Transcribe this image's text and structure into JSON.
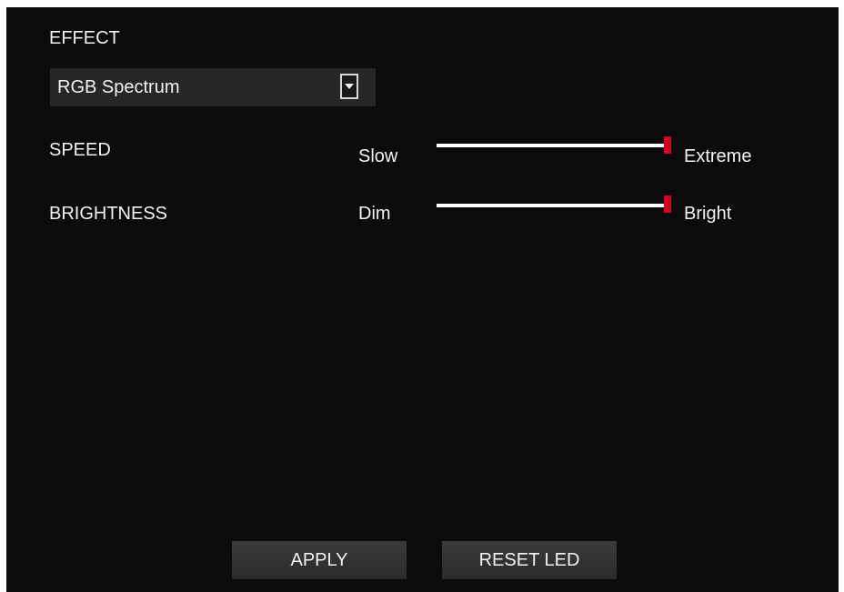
{
  "effect": {
    "label": "EFFECT",
    "selected": "RGB Spectrum"
  },
  "speed": {
    "label": "SPEED",
    "min_label": "Slow",
    "max_label": "Extreme",
    "value_fraction": 1.0
  },
  "brightness": {
    "label": "BRIGHTNESS",
    "min_label": "Dim",
    "max_label": "Bright",
    "value_fraction": 1.0
  },
  "buttons": {
    "apply": "APPLY",
    "reset": "RESET LED"
  },
  "colors": {
    "background": "#0b0b0b",
    "slider_track": "#ffffff",
    "slider_thumb": "#d10024",
    "text": "#f2f2f2"
  },
  "icons": {
    "dropdown": "chevron-down-icon"
  }
}
